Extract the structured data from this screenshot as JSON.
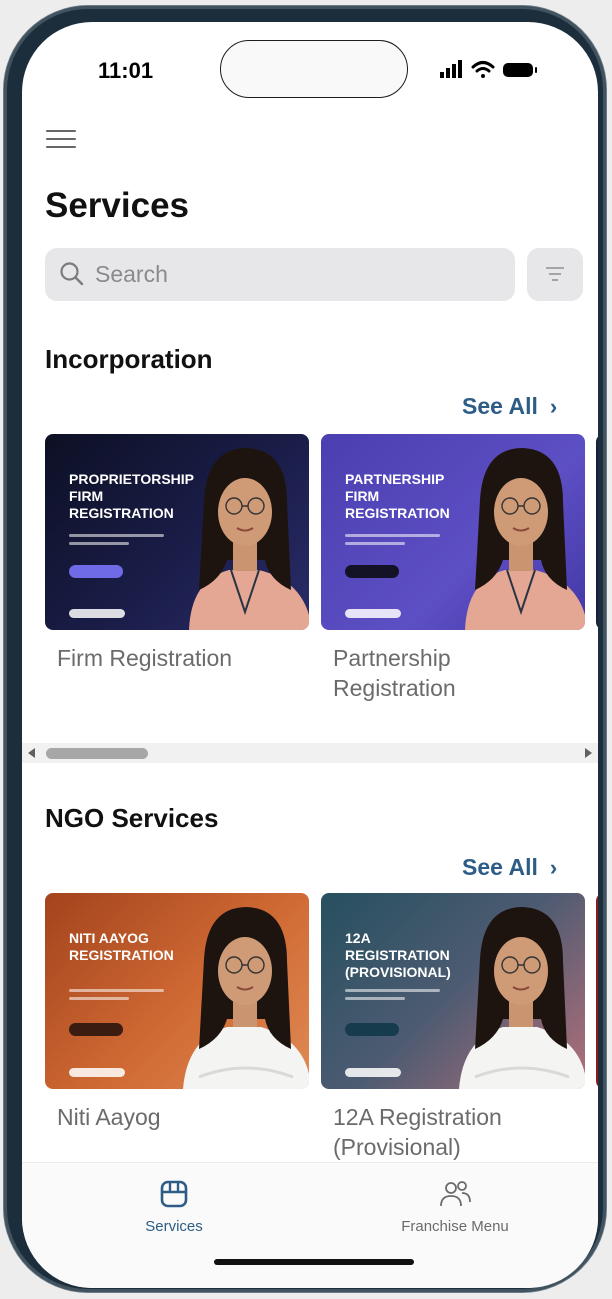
{
  "status_bar": {
    "time": "11:01"
  },
  "header": {
    "title": "Services"
  },
  "search": {
    "placeholder": "Search"
  },
  "sections": [
    {
      "title": "Incorporation",
      "see_all": "See All",
      "cards": [
        {
          "banner_title": "PROPRIETORSHIP FIRM REGISTRATION",
          "label": "Firm Registration"
        },
        {
          "banner_title": "PARTNERSHIP FIRM REGISTRATION",
          "label": "Partnership Registration"
        }
      ]
    },
    {
      "title": "NGO Services",
      "see_all": "See All",
      "cards": [
        {
          "banner_title": "NITI AAYOG REGISTRATION",
          "label": "Niti Aayog"
        },
        {
          "banner_title": "12A REGISTRATION (PROVISIONAL)",
          "label": "12A Registration (Provisional)"
        }
      ]
    }
  ],
  "tab_bar": {
    "tabs": [
      {
        "label": "Services",
        "icon": "storefront-icon",
        "active": true
      },
      {
        "label": "Franchise Menu",
        "icon": "people-icon",
        "active": false
      }
    ]
  },
  "colors": {
    "accent": "#2d5c86",
    "banner_dark_navy": "#15193a",
    "banner_purple": "#5a4dbf",
    "banner_orange": "#c8622e",
    "banner_teal": "#2f5a69"
  }
}
